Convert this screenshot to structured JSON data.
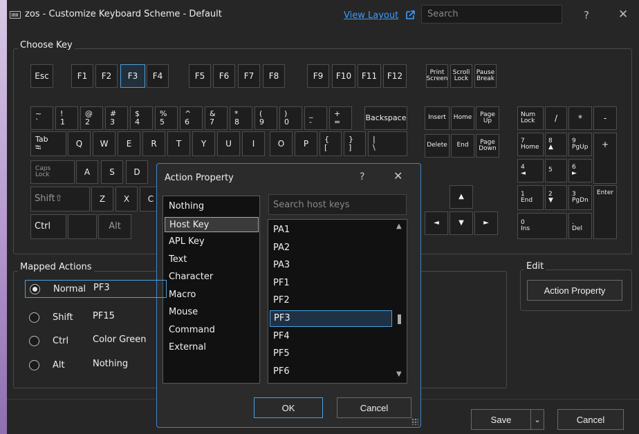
{
  "window": {
    "title": "zos - Customize Keyboard Scheme - Default",
    "view_layout": "View Layout",
    "search_placeholder": "Search",
    "help": "?",
    "close": "✕"
  },
  "choose_key": {
    "label": "Choose Key",
    "function_row": [
      "Esc",
      "F1",
      "F2",
      "F3",
      "F4",
      "F5",
      "F6",
      "F7",
      "F8",
      "F9",
      "F10",
      "F11",
      "F12"
    ],
    "system_keys": [
      [
        "Print",
        "Screen"
      ],
      [
        "Scroll",
        "Lock"
      ],
      [
        "Pause",
        "Break"
      ]
    ],
    "number_row": [
      [
        "~",
        "`"
      ],
      [
        "!",
        "1"
      ],
      [
        "@",
        "2"
      ],
      [
        "#",
        "3"
      ],
      [
        "$",
        "4"
      ],
      [
        "%",
        "5"
      ],
      [
        "^",
        "6"
      ],
      [
        "&",
        "7"
      ],
      [
        "*",
        "8"
      ],
      [
        "(",
        "9"
      ],
      [
        ")",
        "0"
      ],
      [
        "_",
        "-"
      ],
      [
        "+",
        "="
      ]
    ],
    "backspace": "Backspace",
    "tab_key": [
      "Tab",
      "⭾"
    ],
    "qwerty_row": [
      "Q",
      "W",
      "E",
      "R",
      "T",
      "Y",
      "U",
      "I",
      "O",
      "P"
    ],
    "bracket_keys": [
      [
        "{",
        "["
      ],
      [
        "}",
        "]"
      ],
      [
        "|",
        "\\"
      ]
    ],
    "caps": [
      "Caps",
      "Lock"
    ],
    "home_row": [
      "A",
      "S",
      "D"
    ],
    "shift": "Shift⇧",
    "bottom_letters": [
      "Z",
      "X",
      "C"
    ],
    "ctrl": "Ctrl",
    "alt": "Alt",
    "nav_keys": [
      "Insert",
      "Home",
      [
        "Page",
        "Up"
      ],
      "Delete",
      "End",
      [
        "Page",
        "Down"
      ]
    ],
    "arrows": {
      "up": "▲",
      "left": "◄",
      "down": "▼",
      "right": "►"
    },
    "numpad": {
      "numlock": [
        "Num",
        "Lock"
      ],
      "div": "/",
      "mul": "*",
      "minus": "-",
      "n7": [
        "7",
        "Home"
      ],
      "n8": [
        "8",
        "▲"
      ],
      "n9": [
        "9",
        "PgUp"
      ],
      "plus": "+",
      "n4": [
        "4",
        "◄"
      ],
      "n5": "5",
      "n6": [
        "6",
        "►"
      ],
      "n1": [
        "1",
        "End"
      ],
      "n2": [
        "2",
        "▼"
      ],
      "n3": [
        "3",
        "PgDn"
      ],
      "enter": "Enter",
      "n0": [
        "0",
        "Ins"
      ],
      "dot": [
        ".",
        "Del"
      ]
    }
  },
  "mapped_actions": {
    "label": "Mapped Actions",
    "rows": [
      {
        "name": "Normal",
        "value": "PF3",
        "selected": true
      },
      {
        "name": "Shift",
        "value": "PF15",
        "selected": false
      },
      {
        "name": "Ctrl",
        "value": "Color Green",
        "selected": false
      },
      {
        "name": "Alt",
        "value": "Nothing",
        "selected": false
      }
    ]
  },
  "edit": {
    "label": "Edit",
    "action_property": "Action Property"
  },
  "footer": {
    "save": "Save",
    "save_dropdown": "⌄",
    "cancel": "Cancel"
  },
  "dialog": {
    "title": "Action Property",
    "help": "?",
    "close": "✕",
    "categories": [
      "Nothing",
      "Host Key",
      "APL Key",
      "Text",
      "Character",
      "Macro",
      "Mouse",
      "Command",
      "External"
    ],
    "selected_category": "Host Key",
    "search_placeholder": "Search host keys",
    "host_keys": [
      "PA1",
      "PA2",
      "PA3",
      "PF1",
      "PF2",
      "PF3",
      "PF4",
      "PF5",
      "PF6"
    ],
    "selected_host_key": "PF3",
    "scroll_up": "▲",
    "scroll_down": "▼",
    "ok": "OK",
    "cancel": "Cancel"
  },
  "colors": {
    "accent": "#4aa3e0",
    "link": "#3b9dff",
    "background": "#262626"
  }
}
